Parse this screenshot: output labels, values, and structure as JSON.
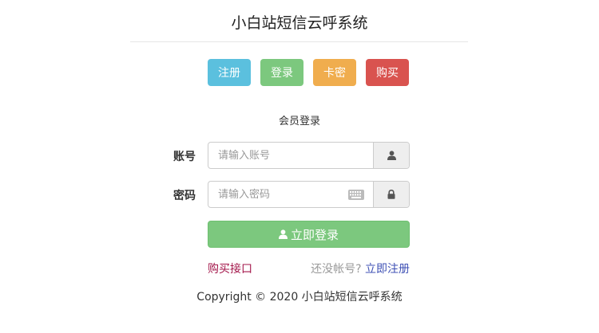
{
  "header": {
    "title": "小白站短信云呼系统"
  },
  "nav": {
    "buttons": [
      {
        "label": "注册",
        "color": "#5bc0de"
      },
      {
        "label": "登录",
        "color": "#7cc87e"
      },
      {
        "label": "卡密",
        "color": "#f0ad4e"
      },
      {
        "label": "购买",
        "color": "#d9534f"
      }
    ]
  },
  "form": {
    "subtitle": "会员登录",
    "account": {
      "label": "账号",
      "placeholder": "请输入账号",
      "icon": "user-icon"
    },
    "password": {
      "label": "密码",
      "placeholder": "请输入密码",
      "icon": "lock-icon",
      "keyboard_icon": "keyboard-icon"
    },
    "submit_label": "立即登录"
  },
  "links": {
    "buy_api": "购买接口",
    "no_account": "还没帐号?",
    "register_now": "立即注册"
  },
  "footer": {
    "copyright": "Copyright © 2020 小白站短信云呼系统"
  },
  "colors": {
    "link_red": "#a3164a",
    "link_blue": "#3f51b5",
    "muted_gray": "#999999"
  }
}
